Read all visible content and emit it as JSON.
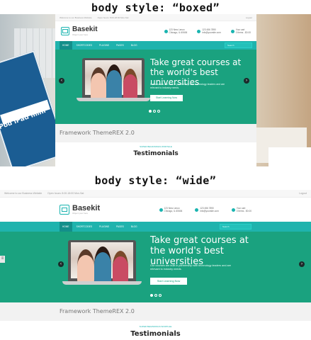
{
  "captions": {
    "boxed": "body style: “boxed”",
    "wide": "body style: “wide”"
  },
  "ipad_box_text": "iPod iPad mini",
  "site": {
    "topbar_left": "Welcome to our Business Website",
    "topbar_hours": "Open hours: 8:00-18:00 Mon-Sat",
    "topbar_right": "Logout",
    "logo_title": "Basekit",
    "logo_sub": "Object your here",
    "address_line1": "123 New Lenox",
    "address_line2": "Chicago, IL 60606",
    "phone_line1": "123 456 7890",
    "phone_line2": "info@yoursite.com",
    "cart_line1": "Your cart",
    "cart_line2": "0 Items - $0.00",
    "nav": [
      "HOME",
      "SHORTCODES",
      "PLUGINS",
      "PAGES",
      "BLOG"
    ],
    "search_placeholder": "Search",
    "slide_title": "Take great courses at the world's best universities",
    "slide_text": "Our courses are built in partnership with technology leaders and are relevant to industry needs.",
    "slide_button": "Start Learning Now",
    "framework": "Framework ThemeREX 2.0",
    "subtitle_small": "SUPER BEGINNINGS WORTHLE",
    "testimonials": "Testimonials"
  },
  "colors": {
    "accent": "#1fb3ad",
    "slide_bg": "#1aa27f"
  }
}
